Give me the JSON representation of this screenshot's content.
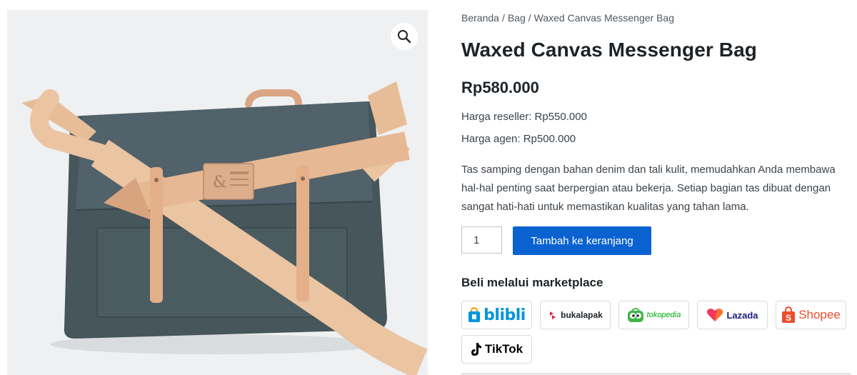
{
  "breadcrumb": {
    "items": [
      "Beranda",
      "Bag",
      "Waxed Canvas Messenger Bag"
    ],
    "separator": "/"
  },
  "product": {
    "title": "Waxed Canvas Messenger Bag",
    "price": "Rp580.000",
    "reseller_price": "Harga reseller: Rp550.000",
    "agent_price": "Harga agen: Rp500.000",
    "description": "Tas samping dengan bahan denim dan tali kulit, memudahkan Anda membawa hal-hal penting saat berpergian atau bekerja. Setiap bagian tas dibuat dengan sangat hati-hati untuk memastikan kualitas yang tahan lama.",
    "badge_symbol": "&"
  },
  "gallery": {
    "zoom_icon": "magnifier-icon"
  },
  "cart": {
    "quantity": "1",
    "add_label": "Tambah ke keranjang"
  },
  "marketplace": {
    "heading": "Beli melalui marketplace",
    "stores": [
      {
        "name": "blibli",
        "label": "blibli",
        "color": "#0095da",
        "icon": "shopping-bag-icon"
      },
      {
        "name": "bukalapak",
        "label": "bukalapak",
        "color": "#e31e52",
        "icon": "bukalapak-logo-icon"
      },
      {
        "name": "tokopedia",
        "label": "tokopedia",
        "color": "#03ac0e",
        "icon": "owl-icon"
      },
      {
        "name": "lazada",
        "label": "Lazada",
        "color": "#f5365c",
        "icon": "heart-icon"
      },
      {
        "name": "shopee",
        "label": "Shopee",
        "color": "#ee4d2d",
        "icon": "shopping-bag-icon"
      },
      {
        "name": "tiktok",
        "label": "TikTok",
        "color": "#000000",
        "icon": "music-note-icon"
      }
    ]
  },
  "colors": {
    "primary_button": "#0a62d0",
    "text": "#1d2327",
    "gallery_bg": "#eef0f2"
  }
}
